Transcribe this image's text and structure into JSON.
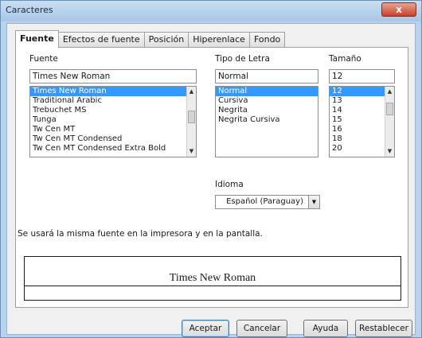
{
  "window": {
    "title": "Caracteres",
    "close_glyph": "x"
  },
  "tabs": [
    {
      "label": "Fuente",
      "active": true
    },
    {
      "label": "Efectos de fuente",
      "active": false
    },
    {
      "label": "Posición",
      "active": false
    },
    {
      "label": "Hiperenlace",
      "active": false
    },
    {
      "label": "Fondo",
      "active": false
    }
  ],
  "font": {
    "label": "Fuente",
    "value": "Times New Roman",
    "list": [
      "Times New Roman",
      "Traditional Arabic",
      "Trebuchet MS",
      "Tunga",
      "Tw Cen MT",
      "Tw Cen MT Condensed",
      "Tw Cen MT Condensed Extra Bold"
    ],
    "selected_index": 0
  },
  "style": {
    "label": "Tipo de Letra",
    "value": "Normal",
    "list": [
      "Normal",
      "Cursiva",
      "Negrita",
      "Negrita Cursiva"
    ],
    "selected_index": 0
  },
  "size": {
    "label": "Tamaño",
    "value": "12",
    "list": [
      "12",
      "13",
      "14",
      "15",
      "16",
      "18",
      "20"
    ],
    "selected_index": 0
  },
  "language": {
    "label": "Idioma",
    "value": "Español (Paraguay)"
  },
  "note": "Se usará la misma fuente en la impresora y en la pantalla.",
  "preview": {
    "text": "Times New Roman"
  },
  "buttons": {
    "ok": "Aceptar",
    "cancel": "Cancelar",
    "help": "Ayuda",
    "reset": "Restablecer"
  }
}
